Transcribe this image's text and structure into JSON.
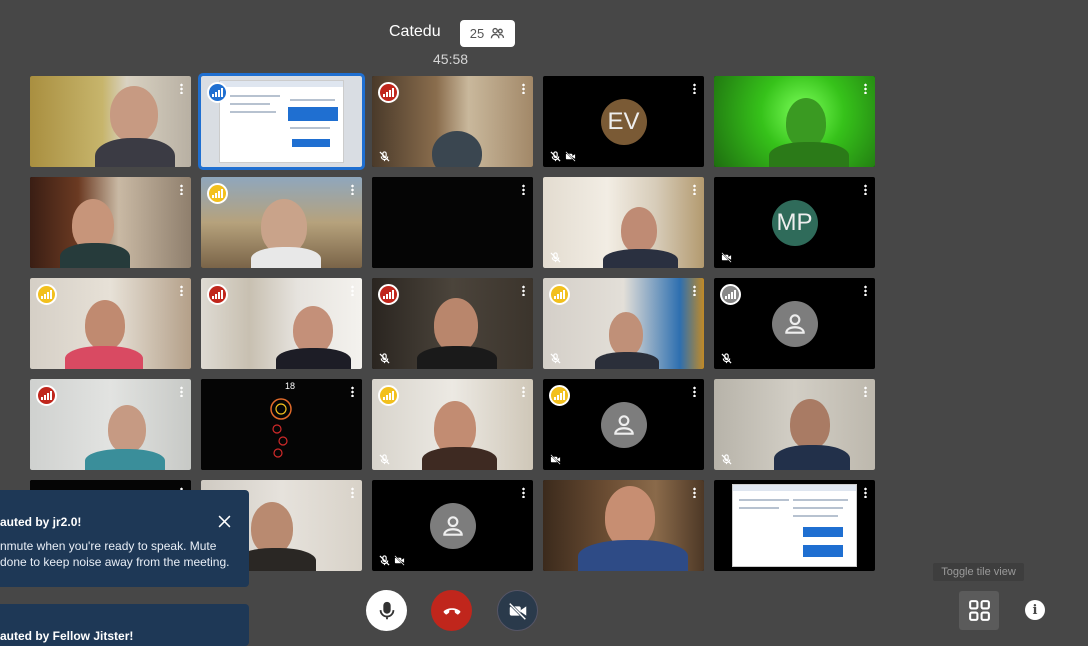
{
  "header": {
    "room_name": "Catedu",
    "participant_count": "25",
    "timer": "45:58"
  },
  "tiles": [
    {
      "id": "r1c1",
      "kind": "video",
      "indicator": null
    },
    {
      "id": "r1c2",
      "kind": "screen",
      "indicator": "blue"
    },
    {
      "id": "r1c3",
      "kind": "video",
      "indicator": "red"
    },
    {
      "id": "r1c4",
      "kind": "initials",
      "initials": "EV",
      "color": "#7a5a35",
      "indicator": null
    },
    {
      "id": "r1c5",
      "kind": "video",
      "indicator": null
    },
    {
      "id": "r2c1",
      "kind": "video",
      "indicator": null
    },
    {
      "id": "r2c2",
      "kind": "video",
      "indicator": "yellow"
    },
    {
      "id": "r2c3",
      "kind": "video",
      "indicator": null
    },
    {
      "id": "r2c4",
      "kind": "video",
      "indicator": null
    },
    {
      "id": "r2c5",
      "kind": "initials",
      "initials": "MP",
      "color": "#2f6b5a",
      "indicator": null
    },
    {
      "id": "r3c1",
      "kind": "video",
      "indicator": "yellow"
    },
    {
      "id": "r3c2",
      "kind": "video",
      "indicator": "red"
    },
    {
      "id": "r3c3",
      "kind": "video",
      "indicator": "red"
    },
    {
      "id": "r3c4",
      "kind": "video",
      "indicator": "yellow"
    },
    {
      "id": "r3c5",
      "kind": "avatar",
      "indicator": "gray"
    },
    {
      "id": "r4c1",
      "kind": "video",
      "indicator": "red"
    },
    {
      "id": "r4c2",
      "kind": "video",
      "indicator": null
    },
    {
      "id": "r4c3",
      "kind": "video",
      "indicator": "yellow"
    },
    {
      "id": "r4c4",
      "kind": "avatar",
      "indicator": "yellow"
    },
    {
      "id": "r4c5",
      "kind": "video",
      "indicator": null
    },
    {
      "id": "r5c1",
      "kind": "video",
      "indicator": null
    },
    {
      "id": "r5c2",
      "kind": "video",
      "indicator": null
    },
    {
      "id": "r5c3",
      "kind": "avatar",
      "indicator": null
    },
    {
      "id": "r5c4",
      "kind": "video",
      "indicator": null
    },
    {
      "id": "r5c5",
      "kind": "screen",
      "indicator": null
    }
  ],
  "overlay_text": {
    "r4c2_counter": "18"
  },
  "notifications": [
    {
      "title": "auted by jr2.0!",
      "line1": "nmute when you're ready to speak. Mute",
      "line2": "done to keep noise away from the meeting."
    },
    {
      "title": "auted by Fellow Jitster!"
    }
  ],
  "toolbar": {
    "tile_view_tooltip": "Toggle tile view",
    "info_label": "i"
  },
  "icons": {
    "mic": "microphone-icon",
    "hangup": "hangup-icon",
    "video": "video-off-icon",
    "tile_view": "tile-view-icon",
    "info": "info-icon",
    "participants": "participants-icon"
  },
  "colors": {
    "background": "#474747",
    "notification_bg": "#1e3856",
    "hangup": "#c0261c",
    "active_border": "#1f6fd1",
    "indicator_red": "#c0261c",
    "indicator_yellow": "#f2c01d",
    "indicator_gray": "#888888"
  }
}
